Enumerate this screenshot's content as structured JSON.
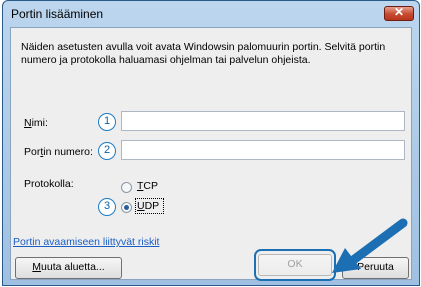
{
  "window": {
    "title": "Portin lisääminen",
    "close_glyph": "✕"
  },
  "description": "Näiden asetusten avulla voit avata Windowsin palomuurin portin. Selvitä portin numero ja protokolla haluamasi ohjelman tai palvelun ohjeista.",
  "form": {
    "name": {
      "label_prefix": "",
      "label_hotkey": "N",
      "label_rest": "imi:",
      "value": "",
      "marker": "1"
    },
    "port": {
      "label_prefix": "Por",
      "label_hotkey": "t",
      "label_rest": "in numero:",
      "value": "",
      "marker": "2"
    },
    "protocol": {
      "label": "Protokolla:",
      "marker": "3",
      "options": [
        {
          "hotkey": "T",
          "rest": "CP",
          "selected": false
        },
        {
          "hotkey": "U",
          "rest": "DP",
          "selected": true
        }
      ]
    }
  },
  "risk_link": "Portin avaamiseen liittyvät riskit",
  "buttons": {
    "change_scope": {
      "hotkey": "M",
      "rest": "uuta aluetta..."
    },
    "ok": "OK",
    "cancel": "Peruuta"
  },
  "colors": {
    "marker": "#1c7cc4",
    "arrow": "#1c6fb3",
    "link": "#1a5ec5"
  },
  "icons": [
    "close-icon",
    "arrow-pointer-icon"
  ]
}
